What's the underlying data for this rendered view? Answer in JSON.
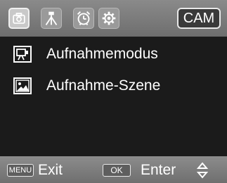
{
  "header": {
    "tabs": [
      {
        "icon": "camera-icon",
        "active": true
      },
      {
        "icon": "tripod-icon",
        "active": false
      },
      {
        "icon": "alarm-clock-icon",
        "active": false
      },
      {
        "icon": "gear-icon",
        "active": false
      }
    ],
    "mode_badge": "CAM"
  },
  "menu": {
    "items": [
      {
        "label": "Aufnahmemodus",
        "icon": "capture-mode-icon"
      },
      {
        "label": "Aufnahme-Szene",
        "icon": "scene-icon"
      }
    ]
  },
  "footer": {
    "menu_key": "MENU",
    "exit_label": "Exit",
    "ok_key": "OK",
    "enter_label": "Enter",
    "nav_icon": "up-down-arrows-icon"
  }
}
